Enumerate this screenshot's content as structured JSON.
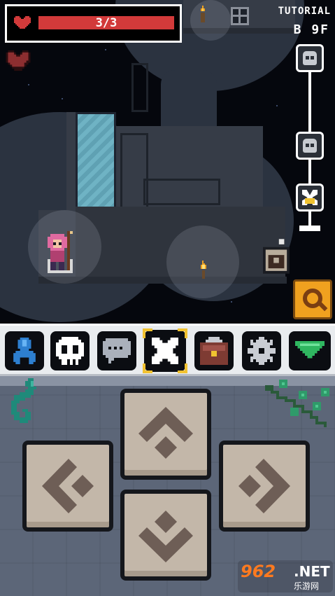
{
  "hud": {
    "hp_text": "3/3",
    "hp_fraction": 1.0,
    "stage": "TUTORIAL",
    "floor": "B 9F"
  },
  "icons": {
    "hp": "heart-icon",
    "bonus": "heart-icon",
    "torch": "torch-icon",
    "map": "map-icon",
    "search": "magnifier-icon",
    "chest": "locked-chest-icon"
  },
  "progress": {
    "nodes": [
      "skull",
      "skull",
      "current-skull"
    ],
    "current_index": 2
  },
  "toolbar": {
    "items": [
      {
        "name": "hero",
        "icon": "character-icon",
        "color": "#2d7fd0"
      },
      {
        "name": "skull",
        "icon": "skull-icon",
        "color": "#ffffff"
      },
      {
        "name": "chat",
        "icon": "chat-bubble-icon",
        "color": "#aab0bb"
      },
      {
        "name": "crossbones",
        "icon": "crossbones-icon",
        "color": "#ffffff",
        "selected": true
      },
      {
        "name": "bag",
        "icon": "bag-icon",
        "color": "#7e3b33"
      },
      {
        "name": "settings",
        "icon": "gear-icon",
        "color": "#c9ccd3"
      },
      {
        "name": "collapse",
        "icon": "chevron-down-icon",
        "color": "#2fb760"
      }
    ]
  },
  "dpad": {
    "buttons": [
      "up",
      "left",
      "right",
      "down"
    ]
  },
  "watermark": {
    "num": "962",
    "net": ".NET",
    "cn": "乐游网"
  },
  "colors": {
    "hp_fill": "#d23a3a",
    "accent": "#f0a11f",
    "selected_corner": "#f2c230",
    "pad_bg": "#5c6678",
    "pad_button": "#c3b7a9"
  }
}
